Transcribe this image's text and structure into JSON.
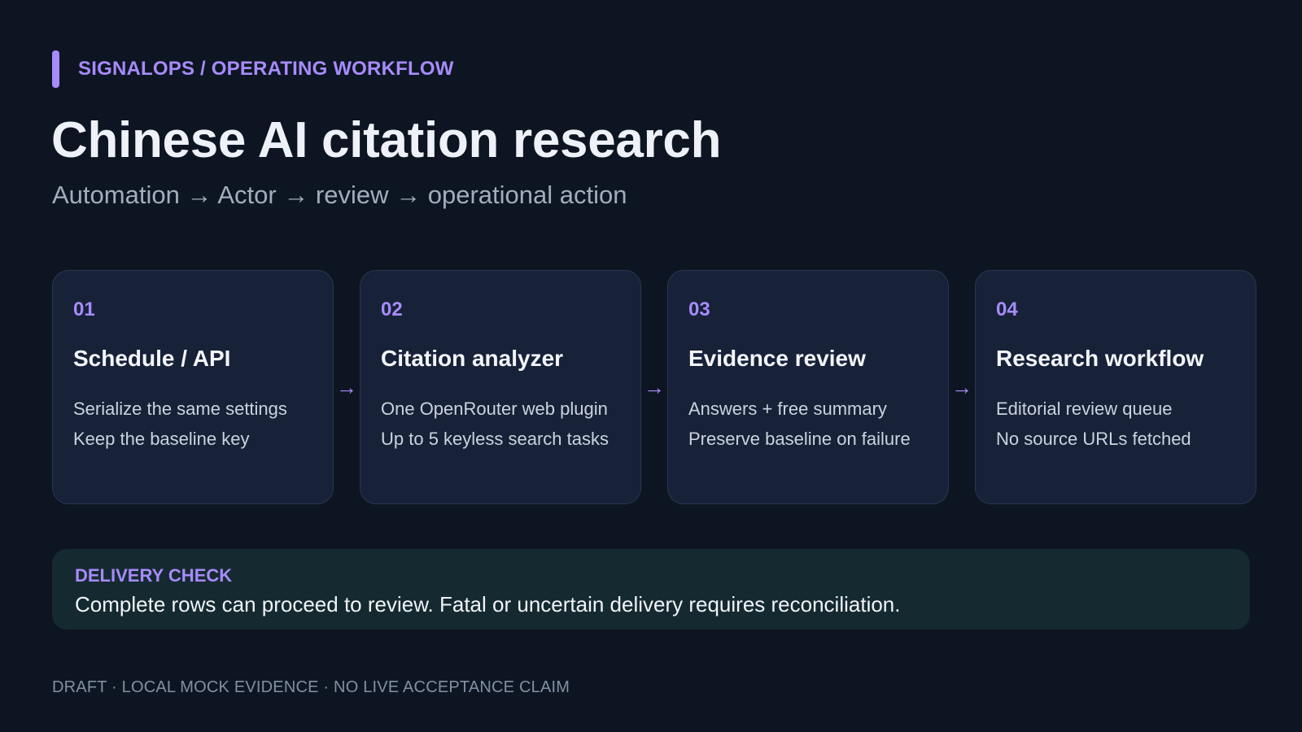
{
  "header": {
    "eyebrow": "SIGNALOPS / OPERATING WORKFLOW",
    "title": "Chinese AI citation research",
    "subtitle": "Automation → Actor → review → operational action"
  },
  "steps": [
    {
      "num": "01",
      "title": "Schedule / API",
      "lines": [
        "Serialize the same settings",
        "Keep the baseline key"
      ]
    },
    {
      "num": "02",
      "title": "Citation analyzer",
      "lines": [
        "One OpenRouter web plugin",
        "Up to 5 keyless search tasks"
      ]
    },
    {
      "num": "03",
      "title": "Evidence review",
      "lines": [
        "Answers + free summary",
        "Preserve baseline on failure"
      ]
    },
    {
      "num": "04",
      "title": "Research workflow",
      "lines": [
        "Editorial review queue",
        "No source URLs fetched"
      ]
    }
  ],
  "arrow_glyph": "→",
  "delivery": {
    "label": "DELIVERY CHECK",
    "text": "Complete rows can proceed to review. Fatal or uncertain delivery requires reconciliation."
  },
  "footer": "DRAFT · LOCAL MOCK EVIDENCE · NO LIVE ACCEPTANCE CLAIM",
  "colors": {
    "background": "#0d1522",
    "accent": "#a78bfa",
    "card": "#172239",
    "delivery_panel": "#152a30"
  }
}
